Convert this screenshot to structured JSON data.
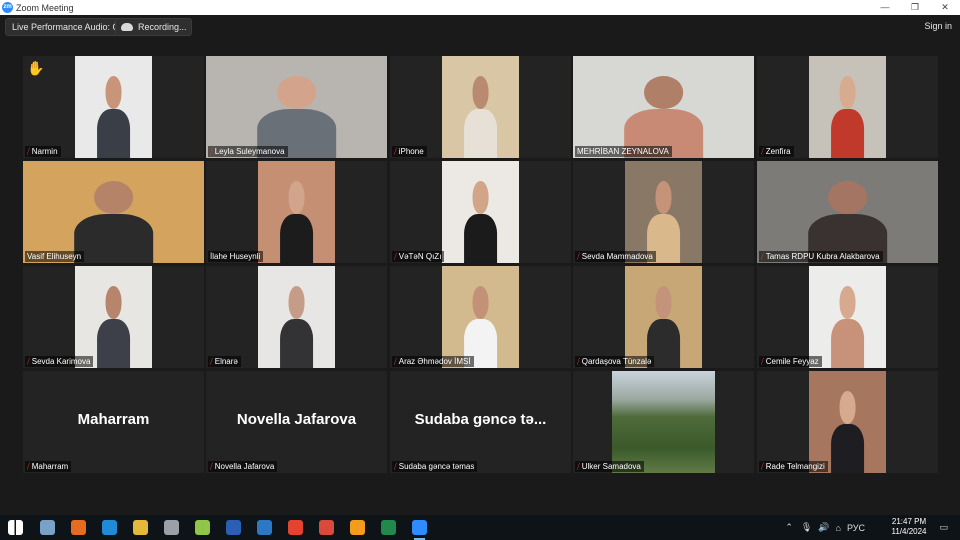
{
  "window": {
    "title": "Zoom Meeting",
    "minimize": "—",
    "maximize": "❐",
    "close": "✕"
  },
  "toolbar": {
    "live_audio": "Live Performance Audio: Off",
    "recording": "Recording...",
    "signin": "Sign in"
  },
  "participants": [
    {
      "name": "Narmin",
      "muted": true,
      "raised_hand": true
    },
    {
      "name": "Leyla Suleymanova",
      "muted": true
    },
    {
      "name": "iPhone",
      "muted": true
    },
    {
      "name": "MEHRİBAN ZEYNALOVA",
      "muted": false,
      "active_speaker": true
    },
    {
      "name": "Zenfira",
      "muted": true
    },
    {
      "name": "Vasif Elihuseyn",
      "muted": false
    },
    {
      "name": "İlahe Huseynli",
      "muted": false
    },
    {
      "name": "VəTəN QıZı",
      "muted": true
    },
    {
      "name": "Sevda Mammadova",
      "muted": true
    },
    {
      "name": "Tamas RDPU Kubra Alakbarova",
      "muted": true
    },
    {
      "name": "Sevda Karimova",
      "muted": true
    },
    {
      "name": "Elnarə",
      "muted": true
    },
    {
      "name": "Araz Əhmədov İMSİ",
      "muted": true
    },
    {
      "name": "Qardaşova Tünzalə",
      "muted": true
    },
    {
      "name": "Cemile Feyyaz",
      "muted": true
    },
    {
      "name": "Maharram",
      "muted": true,
      "display_name": "Maharram"
    },
    {
      "name": "Novella Jafarova",
      "muted": true,
      "display_name": "Novella Jafarova"
    },
    {
      "name": "Sudaba gəncə təmas",
      "muted": true,
      "display_name": "Sudaba gəncə tə..."
    },
    {
      "name": "Ulker Samadova",
      "muted": true
    },
    {
      "name": "Rade Telmangizi",
      "muted": true
    }
  ],
  "taskbar": {
    "tray_lang": "РУС",
    "time": "21:47 PM",
    "date": "11/4/2024"
  },
  "colors": {
    "active_speaker_border": "#9bd64a",
    "muted_icon": "#e0403a",
    "zoom_blue": "#2d8cff"
  }
}
